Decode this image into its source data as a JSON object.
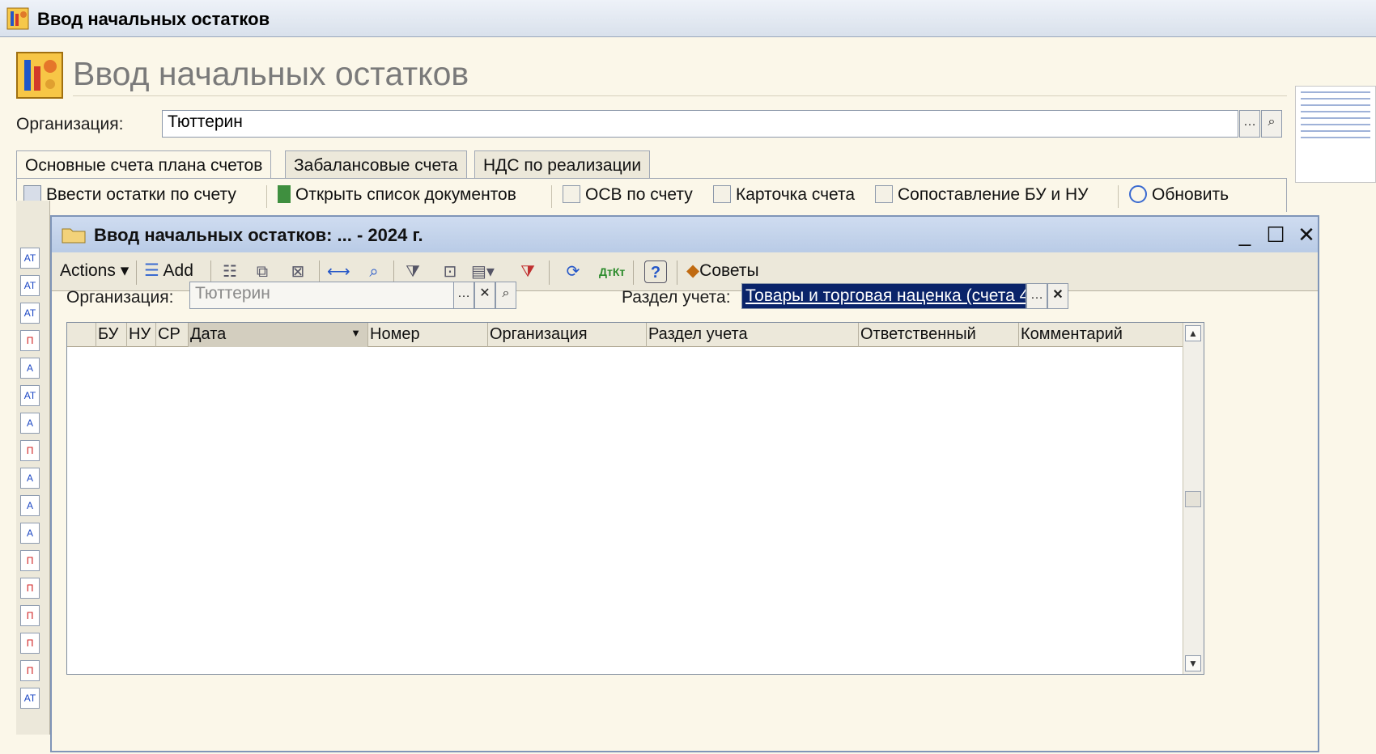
{
  "outer": {
    "window_title": "Ввод начальных остатков",
    "header_title": "Ввод начальных остатков",
    "org_label": "Организация:",
    "org_value": "Тюттерин",
    "tabs": [
      {
        "label": "Основные счета плана счетов",
        "active": true
      },
      {
        "label": "Забалансовые счета",
        "active": false
      },
      {
        "label": "НДС по реализации",
        "active": false
      }
    ],
    "toolbar": {
      "enter_balances": "Ввести остатки по счету",
      "open_doc_list": "Открыть список документов",
      "osv": "ОСВ по счету",
      "account_card": "Карточка счета",
      "compare": "Сопоставление БУ и НУ",
      "refresh": "Обновить"
    }
  },
  "inner": {
    "window_title": "Ввод начальных остатков: ... - 2024 г.",
    "toolbar": {
      "actions": "Actions",
      "add": "Add",
      "tips": "Советы"
    },
    "org_label": "Организация:",
    "org_value": "Тюттерин",
    "section_label": "Раздел учета:",
    "section_value": "Товары и торговая наценка (счета 4",
    "columns": [
      "БУ",
      "НУ",
      "СР",
      "Дата",
      "Номер",
      "Организация",
      "Раздел учета",
      "Ответственный",
      "Комментарий"
    ],
    "rows": []
  },
  "icons": [
    "app-icon",
    "folder-icon",
    "minimize-icon",
    "maximize-icon",
    "close-icon",
    "search-icon",
    "clear-icon",
    "help-icon",
    "refresh-icon"
  ],
  "colors": {
    "body_bg": "#fbf7e9",
    "title_bar": "#c4d3ea",
    "selection": "#0a246a"
  }
}
